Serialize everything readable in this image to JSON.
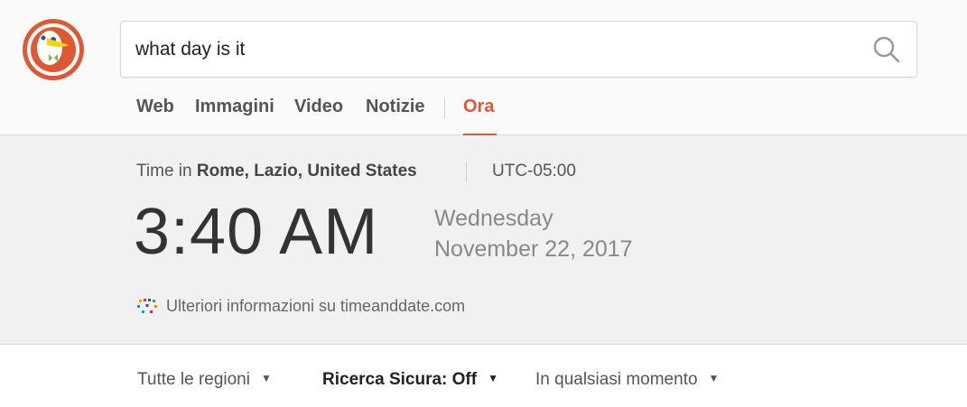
{
  "search": {
    "query": "what day is it"
  },
  "tabs": [
    {
      "label": "Web"
    },
    {
      "label": "Immagini"
    },
    {
      "label": "Video"
    },
    {
      "label": "Notizie"
    },
    {
      "label": "Ora"
    }
  ],
  "active_tab": "Ora",
  "time_panel": {
    "prefix": "Time in",
    "location": "Rome, Lazio, United States",
    "utc_offset": "UTC-05:00",
    "time": "3:40 AM",
    "weekday": "Wednesday",
    "date": "November 22, 2017",
    "source_link": "Ulteriori informazioni su timeanddate.com"
  },
  "filters": {
    "region": "Tutte le regioni",
    "safe_search": "Ricerca Sicura: Off",
    "time_range": "In qualsiasi momento"
  },
  "icons": {
    "logo": "duckduckgo-logo",
    "search": "search-icon",
    "source": "timeanddate-icon",
    "caret": "caret-down-icon"
  },
  "colors": {
    "accent": "#de5833",
    "header_bg": "#fafafa",
    "panel_bg": "#f1f1f1",
    "logo_green": "#4caf50"
  }
}
